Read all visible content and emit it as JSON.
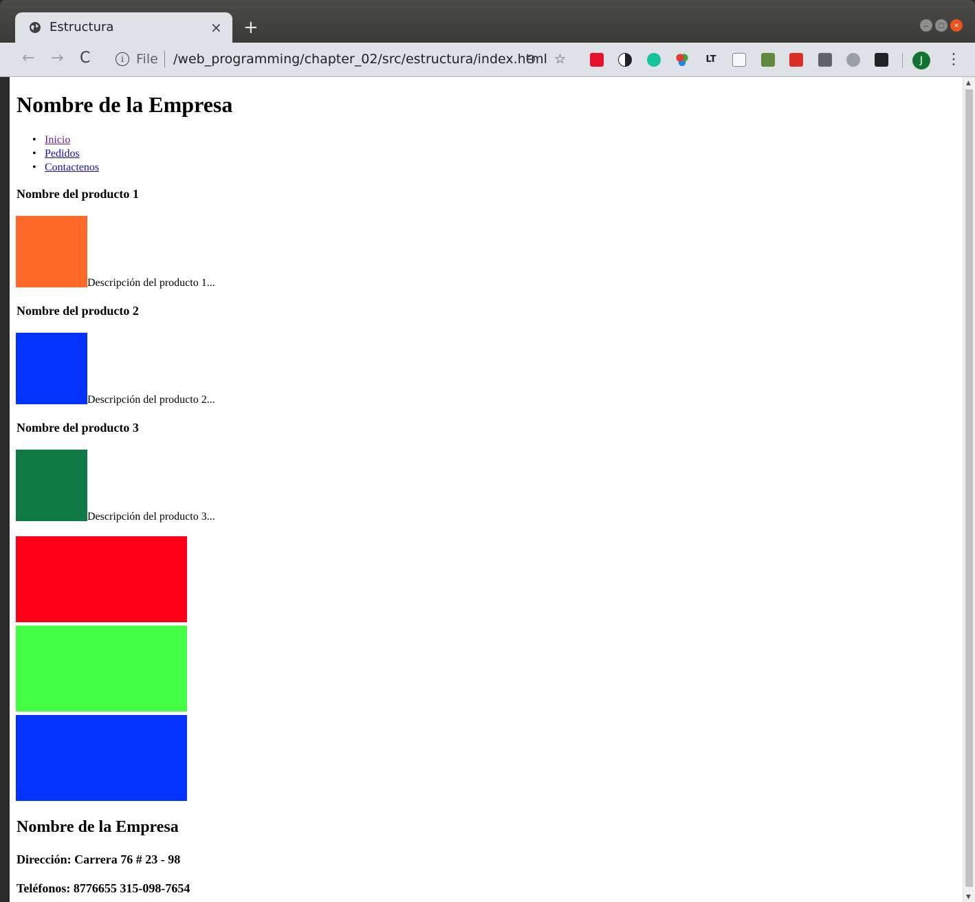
{
  "browser": {
    "tab_title": "Estructura",
    "tab_close": "×",
    "new_tab": "+",
    "url_scheme": "File",
    "url": "/web_programming/chapter_02/src/estructura/index.html",
    "profile_initial": "J"
  },
  "page": {
    "company_name": "Nombre de la Empresa",
    "nav": [
      {
        "label": "Inicio",
        "visited": true
      },
      {
        "label": "Pedidos",
        "visited": false
      },
      {
        "label": "Contactenos",
        "visited": false
      }
    ],
    "products": [
      {
        "name": "Nombre del producto 1",
        "description": "Descripción del producto 1...",
        "color": "#ff6a2a"
      },
      {
        "name": "Nombre del producto 2",
        "description": "Descripción del producto 2...",
        "color": "#0433ff"
      },
      {
        "name": "Nombre del producto 3",
        "description": "Descripción del producto 3...",
        "color": "#0f7a45"
      }
    ],
    "banners": [
      "#ff0019",
      "#44ff44",
      "#0433ff"
    ],
    "footer": {
      "company_name": "Nombre de la Empresa",
      "address": "Dirección: Carrera 76 # 23 - 98",
      "phones": "Teléfonos: 8776655 315-098-7654"
    }
  },
  "colors": {
    "link": "#1a0dab",
    "link_visited": "#681da8"
  }
}
